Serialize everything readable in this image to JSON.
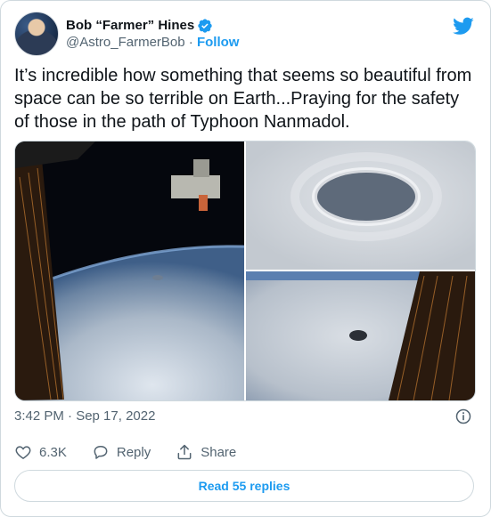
{
  "author": {
    "display_name": "Bob “Farmer” Hines",
    "handle": "@Astro_FarmerBob",
    "separator": "·",
    "follow_label": "Follow"
  },
  "tweet": {
    "text": "It’s incredible how something that seems so beautiful from space can be so terrible on Earth...Praying for the safety of those in the path of Typhoon Nanmadol.",
    "timestamp": "3:42 PM · Sep 17, 2022"
  },
  "actions": {
    "likes": "6.3K",
    "reply_label": "Reply",
    "share_label": "Share"
  },
  "read_replies_label": "Read 55 replies",
  "colors": {
    "accent": "#1d9bf0",
    "text_primary": "#0f1419",
    "text_secondary": "#536471",
    "border": "#cfd9de"
  },
  "icons": [
    "verified-badge-icon",
    "twitter-bird-icon",
    "info-icon",
    "heart-icon",
    "reply-icon",
    "share-icon"
  ]
}
